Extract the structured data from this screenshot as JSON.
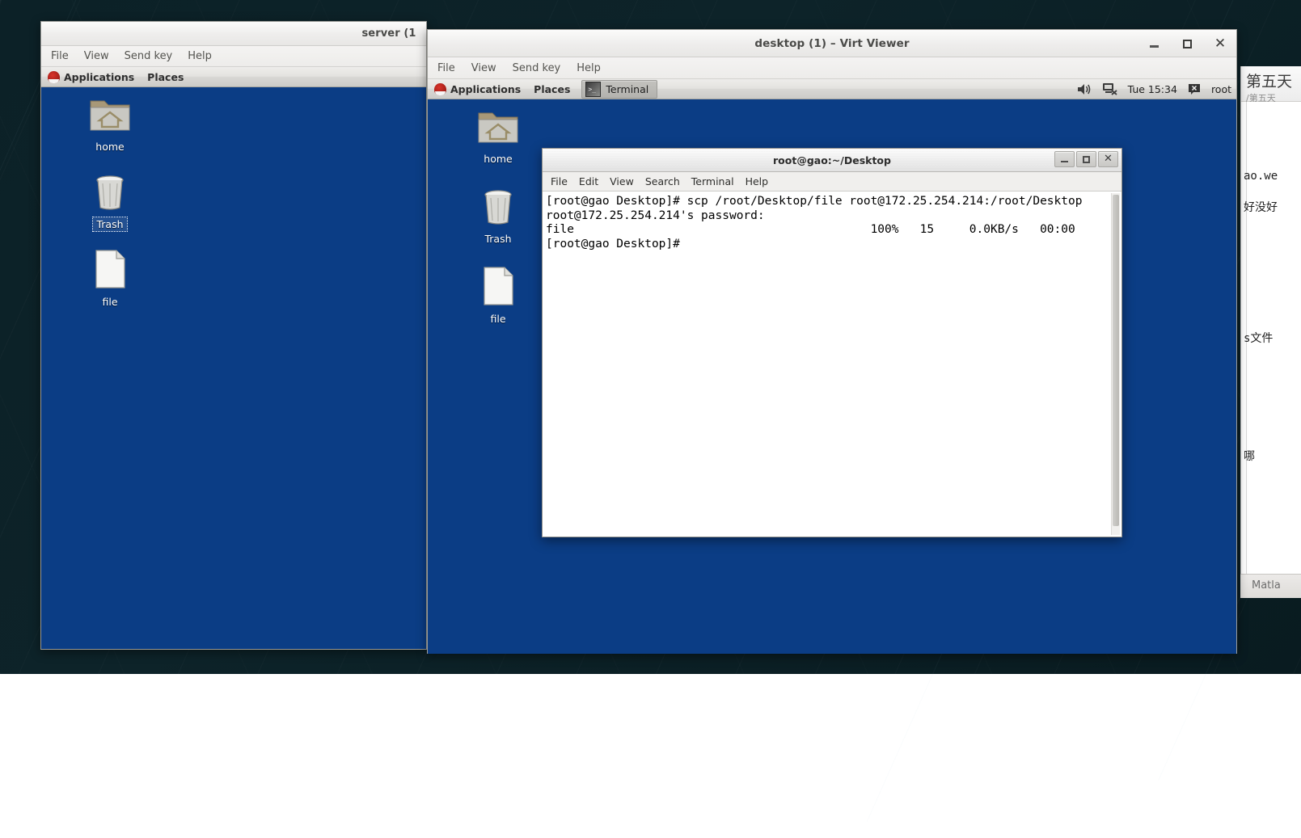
{
  "root_desktop": {
    "name": "host-desktop-background"
  },
  "background_app": {
    "title_cn": "第五天",
    "subtitle_cn": "/第五天",
    "lines": [
      "ao.we",
      "好没好",
      "s文件",
      "哪"
    ],
    "taskbar_item": "Matla"
  },
  "server_window": {
    "title": "server (1",
    "menu": [
      "File",
      "View",
      "Send key",
      "Help"
    ],
    "panel": {
      "applications": "Applications",
      "places": "Places",
      "logo_icon": "red-hat-icon"
    },
    "desktop_icons": [
      {
        "label": "home",
        "icon": "home-folder-icon",
        "selected": false
      },
      {
        "label": "Trash",
        "icon": "trash-icon",
        "selected": true
      },
      {
        "label": "file",
        "icon": "document-icon",
        "selected": false
      }
    ]
  },
  "desktop_window": {
    "title": "desktop (1) – Virt Viewer",
    "menu": [
      "File",
      "View",
      "Send key",
      "Help"
    ],
    "window_buttons": {
      "minimize": "minimize-icon",
      "maximize": "maximize-icon",
      "close": "✕"
    },
    "panel": {
      "applications": "Applications",
      "places": "Places",
      "logo_icon": "red-hat-icon",
      "task_button": {
        "label": "Terminal",
        "icon": "terminal-icon",
        "prompt": ">_"
      },
      "tray": {
        "volume_icon": "volume-icon",
        "network_icon": "network-disconnected-icon",
        "clock": "Tue 15:34",
        "user_icon": "user-status-icon",
        "user": "root"
      }
    },
    "desktop_icons": [
      {
        "label": "home",
        "icon": "home-folder-icon",
        "selected": false
      },
      {
        "label": "Trash",
        "icon": "trash-icon",
        "selected": false
      },
      {
        "label": "file",
        "icon": "document-icon",
        "selected": false
      }
    ]
  },
  "terminal": {
    "title": "root@gao:~/Desktop",
    "menu": [
      "File",
      "Edit",
      "View",
      "Search",
      "Terminal",
      "Help"
    ],
    "window_buttons": {
      "minimize": "minimize-icon",
      "maximize": "maximize-icon",
      "close": "✕"
    },
    "content": "[root@gao Desktop]# scp /root/Desktop/file root@172.25.254.214:/root/Desktop\nroot@172.25.254.214's password:\nfile                                          100%   15     0.0KB/s   00:00\n[root@gao Desktop]#",
    "lines": [
      "[root@gao Desktop]# scp /root/Desktop/file root@172.25.254.214:/root/Desktop",
      "root@172.25.254.214's password:",
      "file                                          100%   15     0.0KB/s   00:00",
      "[root@gao Desktop]#"
    ],
    "transfer": {
      "filename": "file",
      "percent": "100%",
      "size": "15",
      "rate": "0.0KB/s",
      "eta": "00:00"
    }
  },
  "colors": {
    "guest_desktop_blue": "#0b3d85",
    "host_background": "#0d2329",
    "panel_gray": "#e3e2df",
    "terminal_bg": "#ffffff",
    "terminal_fg": "#000000"
  }
}
